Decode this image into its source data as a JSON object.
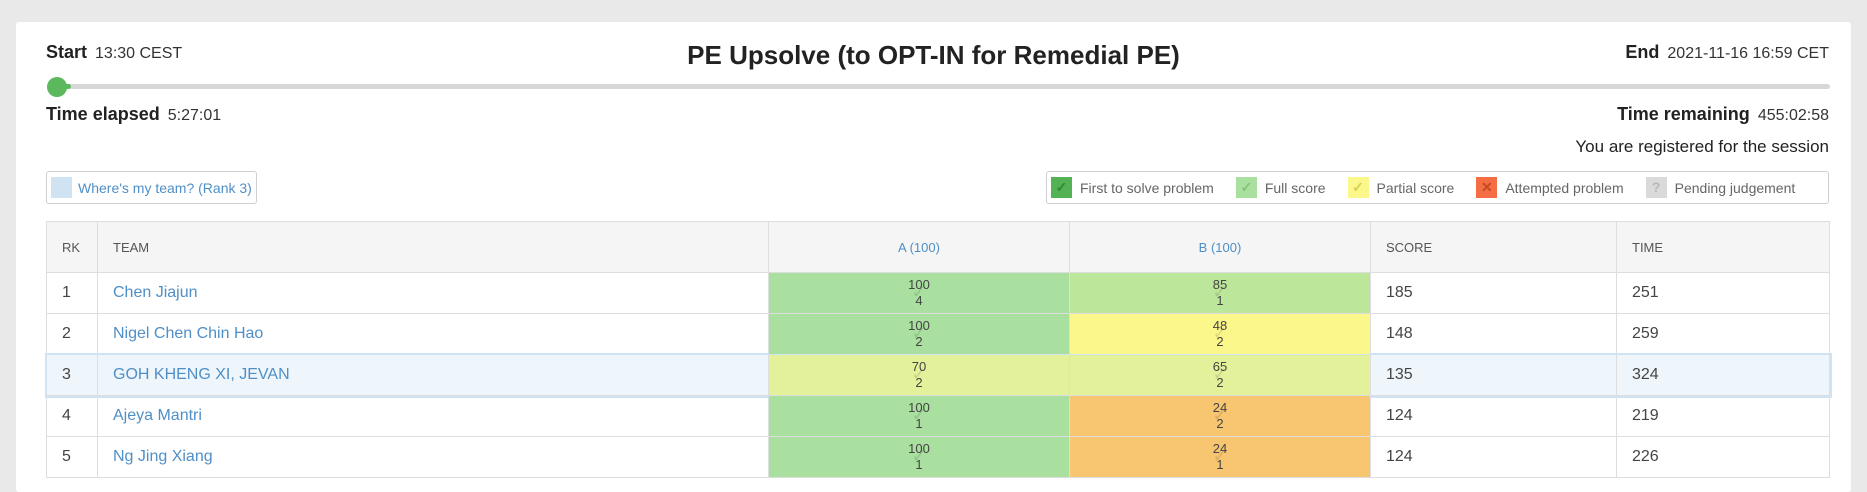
{
  "header": {
    "start_label": "Start",
    "start_value": "13:30 CEST",
    "title": "PE Upsolve (to OPT-IN for Remedial PE)",
    "end_label": "End",
    "end_value": "2021-11-16 16:59 CET",
    "elapsed_label": "Time elapsed",
    "elapsed_value": "5:27:01",
    "remaining_label": "Time remaining",
    "remaining_value": "455:02:58",
    "registered_text": "You are registered for the session",
    "progress_fraction": 0.012
  },
  "my_team_button": "Where's my team? (Rank 3)",
  "legend": [
    {
      "label": "First to solve problem",
      "color": "#53b253",
      "icon": "check-icon"
    },
    {
      "label": "Full score",
      "color": "#a9df9f",
      "icon": "check-icon"
    },
    {
      "label": "Partial score",
      "color": "#fbf78a",
      "icon": "check-icon"
    },
    {
      "label": "Attempted problem",
      "color": "#f46d43",
      "icon": "cross-icon"
    },
    {
      "label": "Pending judgement",
      "color": "#dadada",
      "icon": "question-icon"
    }
  ],
  "table": {
    "headers": {
      "rank": "RK",
      "team": "TEAM",
      "a": "A (100)",
      "b": "B (100)",
      "score": "SCORE",
      "time": "TIME"
    },
    "rows": [
      {
        "rank": "1",
        "team": "Chen Jiajun",
        "a_pts": "100",
        "a_att": "4",
        "a_color": "#a9df9f",
        "b_pts": "85",
        "b_att": "1",
        "b_color": "#bce69a",
        "score": "185",
        "time": "251"
      },
      {
        "rank": "2",
        "team": "Nigel Chen Chin Hao",
        "a_pts": "100",
        "a_att": "2",
        "a_color": "#a9df9f",
        "b_pts": "48",
        "b_att": "2",
        "b_color": "#fbf78a",
        "score": "148",
        "time": "259"
      },
      {
        "rank": "3",
        "team": "GOH KHENG XI, JEVAN",
        "a_pts": "70",
        "a_att": "2",
        "a_color": "#e3f19a",
        "b_pts": "65",
        "b_att": "2",
        "b_color": "#e3f19a",
        "score": "135",
        "time": "324"
      },
      {
        "rank": "4",
        "team": "Ajeya Mantri",
        "a_pts": "100",
        "a_att": "1",
        "a_color": "#a9df9f",
        "b_pts": "24",
        "b_att": "2",
        "b_color": "#f8c571",
        "score": "124",
        "time": "219"
      },
      {
        "rank": "5",
        "team": "Ng Jing Xiang",
        "a_pts": "100",
        "a_att": "1",
        "a_color": "#a9df9f",
        "b_pts": "24",
        "b_att": "1",
        "b_color": "#f8c571",
        "score": "124",
        "time": "226"
      }
    ]
  }
}
